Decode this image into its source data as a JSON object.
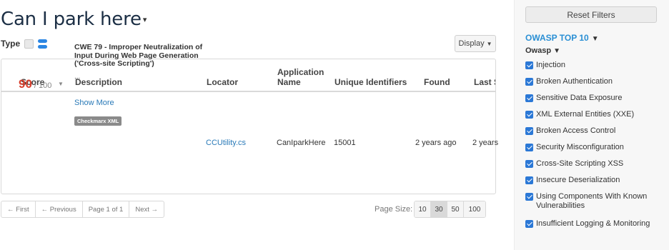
{
  "title": "Can I park here",
  "type_filter": {
    "label": "Type"
  },
  "display_button": {
    "label": "Display"
  },
  "table": {
    "headers": {
      "score": "Score",
      "description": "Description",
      "locator": "Locator",
      "application_name_line1": "Application",
      "application_name_line2": "Name",
      "unique_identifiers": "Unique Identifiers",
      "found": "Found",
      "last_seen": "Last S"
    },
    "row": {
      "score": "90",
      "score_max": "/ 100",
      "description": "CWE 79 - Improper Neutralization of Input During Web Page Generation ('Cross-site Scripting')",
      "ellipsis": "...",
      "show_more": "Show More",
      "tag": "Checkmarx XML",
      "locator": "CCUtility.cs",
      "application_name": "CanIparkHere",
      "unique_identifier": "15001",
      "found": "2 years ago",
      "last_seen": "2 years"
    }
  },
  "pagination": {
    "first": "← First",
    "previous": "← Previous",
    "page_info": "Page 1 of 1",
    "next": "Next →",
    "page_size_label": "Page Size:",
    "page_sizes": [
      "10",
      "30",
      "50",
      "100"
    ],
    "active_page_size": "30"
  },
  "filters_panel": {
    "reset_label": "Reset Filters",
    "section_title": "OWASP TOP 10",
    "group_label": "Owasp",
    "items": [
      "Injection",
      "Broken Authentication",
      "Sensitive Data Exposure",
      "XML External Entities (XXE)",
      "Broken Access Control",
      "Security Misconfiguration",
      "Cross-Site Scripting XSS",
      "Insecure Deserialization",
      "Using Components With Known Vulnerabilities",
      "Insufficient Logging & Monitoring"
    ]
  },
  "colors": {
    "title": "#1c2f45",
    "score": "#d9412f",
    "link": "#2a7ab8",
    "owasp_title": "#2a8fd4",
    "checkbox": "#2b78d6"
  }
}
